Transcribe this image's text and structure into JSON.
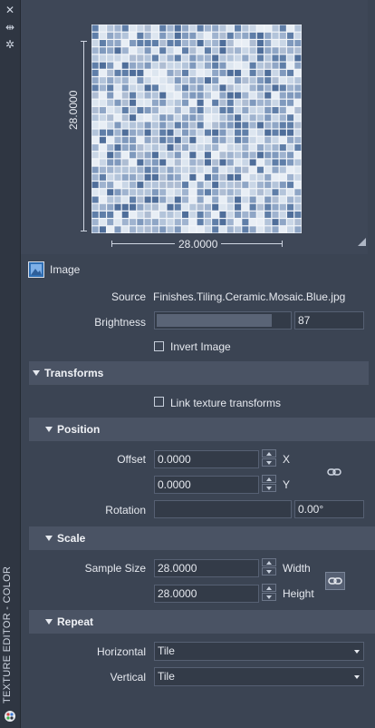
{
  "side_panel": {
    "vertical_title": "TEXTURE EDITOR - COLOR",
    "icons": [
      "close-icon",
      "pin-icon",
      "settings-icon",
      "paint-palette-icon"
    ]
  },
  "preview": {
    "dimension_vertical": "28.0000",
    "dimension_horizontal": "28.0000"
  },
  "image_section": {
    "title": "Image",
    "source_label": "Source",
    "source_value": "Finishes.Tiling.Ceramic.Mosaic.Blue.jpg",
    "brightness_label": "Brightness",
    "brightness_value": "87",
    "brightness_fraction": 0.87,
    "invert_label": "Invert Image"
  },
  "transforms": {
    "title": "Transforms",
    "link_label": "Link texture transforms"
  },
  "position": {
    "title": "Position",
    "offset_label": "Offset",
    "offset_x": "0.0000",
    "offset_y": "0.0000",
    "x_label": "X",
    "y_label": "Y",
    "rotation_label": "Rotation",
    "rotation_value": "0.00°"
  },
  "scale": {
    "title": "Scale",
    "sample_size_label": "Sample Size",
    "width_value": "28.0000",
    "height_value": "28.0000",
    "width_label": "Width",
    "height_label": "Height"
  },
  "repeat": {
    "title": "Repeat",
    "horizontal_label": "Horizontal",
    "horizontal_value": "Tile",
    "vertical_label": "Vertical",
    "vertical_value": "Tile"
  },
  "colors": {
    "panel_bg": "#3b4453",
    "header_bg": "#4a5364",
    "tile_palette": [
      "#c9d6e6",
      "#b3c4da",
      "#9fb3cf",
      "#7f99bd",
      "#5f7ea8",
      "#dde6f0",
      "#8fa6c6",
      "#4f6e9a",
      "#aebdd3",
      "#e8eef5"
    ]
  }
}
